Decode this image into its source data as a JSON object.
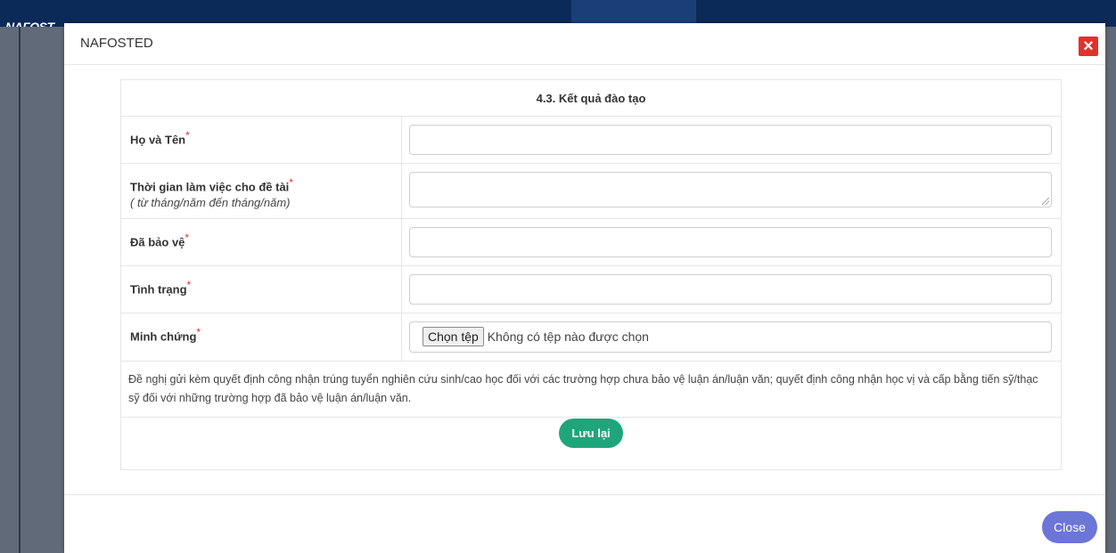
{
  "background": {
    "logo": "NAFOST"
  },
  "modal": {
    "title": "NAFOSTED",
    "close_x": "×",
    "section_title": "4.3. Kết quả đào tạo",
    "fields": [
      {
        "label": "Họ và Tên",
        "required_mark": "*"
      },
      {
        "label": "Thời gian làm việc cho đề tài",
        "required_mark": "*",
        "hint": "( từ tháng/năm đến tháng/năm)"
      },
      {
        "label": "Đã bảo vệ",
        "required_mark": "*"
      },
      {
        "label": "Tình trạng",
        "required_mark": "*"
      },
      {
        "label": "Minh chứng",
        "required_mark": "*"
      }
    ],
    "file_input": {
      "button_label": "Chọn tệp",
      "status": "Không có tệp nào được chọn"
    },
    "note": "Đề nghị gửi kèm quyết định công nhận trúng tuyển nghiên cứu sinh/cao học đối với các trường hợp chưa bảo vệ luận án/luận văn; quyết định công nhận học vị và cấp bằng tiến sỹ/thạc sỹ đối với những trường hợp đã bảo vệ luận án/luận văn.",
    "save_label": "Lưu lại",
    "close_label": "Close"
  },
  "colors": {
    "save_button": "#1ea67a",
    "close_button": "#6c75d8",
    "close_x": "#e0322c",
    "required": "#e0322c"
  }
}
